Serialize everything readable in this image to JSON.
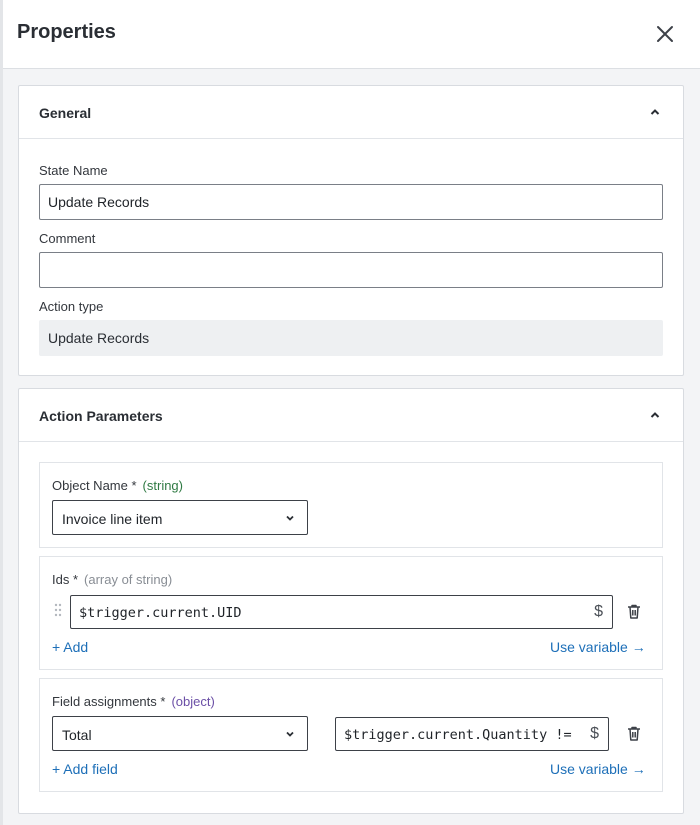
{
  "header": {
    "title": "Properties",
    "close_icon": "close-icon"
  },
  "general": {
    "title": "General",
    "state_name_label": "State Name",
    "state_name_value": "Update Records",
    "comment_label": "Comment",
    "comment_value": "",
    "action_type_label": "Action type",
    "action_type_value": "Update Records"
  },
  "action_params": {
    "title": "Action Parameters",
    "object_name": {
      "label": "Object Name *",
      "type": "(string)",
      "selected": "Invoice line item"
    },
    "ids": {
      "label": "Ids *",
      "type": "(array of string)",
      "value": "$trigger.current.UID",
      "var_symbol": "$",
      "add_label": "+ Add",
      "use_variable_label": "Use variable →"
    },
    "field_assignments": {
      "label": "Field assignments *",
      "type": "(object)",
      "field_selected": "Total",
      "value": "$trigger.current.Quantity != ",
      "var_symbol": "$",
      "add_label": "+ Add field",
      "use_variable_label": "Use variable →"
    }
  },
  "colors": {
    "link": "#1d6fb8",
    "type_string": "#2f7a43",
    "type_object": "#6b4fa6"
  }
}
